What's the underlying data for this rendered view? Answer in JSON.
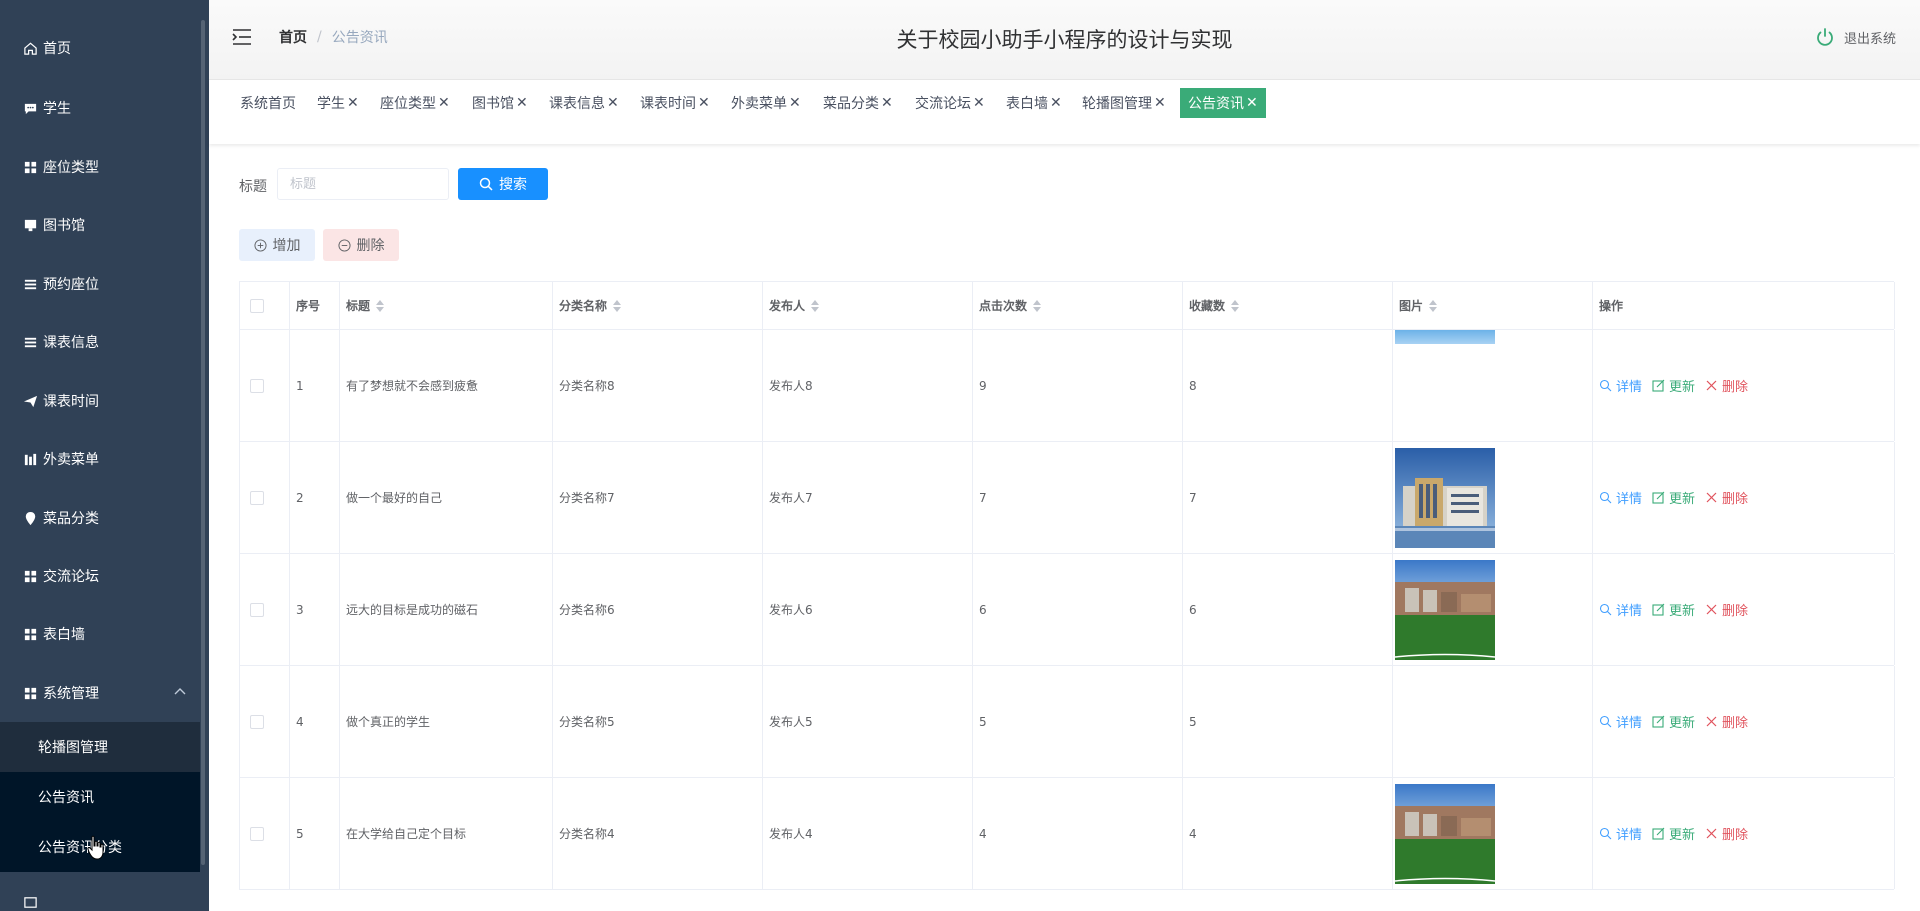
{
  "sidebar": {
    "items": [
      {
        "label": "首页",
        "icon": "home-icon"
      },
      {
        "label": "学生",
        "icon": "chat-icon"
      },
      {
        "label": "座位类型",
        "icon": "grid-icon"
      },
      {
        "label": "图书馆",
        "icon": "board-icon"
      },
      {
        "label": "预约座位",
        "icon": "list-icon"
      },
      {
        "label": "课表信息",
        "icon": "list-icon"
      },
      {
        "label": "课表时间",
        "icon": "send-icon"
      },
      {
        "label": "外卖菜单",
        "icon": "chart-icon"
      },
      {
        "label": "菜品分类",
        "icon": "location-icon"
      },
      {
        "label": "交流论坛",
        "icon": "grid-icon"
      },
      {
        "label": "表白墙",
        "icon": "grid-icon"
      },
      {
        "label": "系统管理",
        "icon": "grid-icon"
      }
    ],
    "sub_items": [
      {
        "label": "轮播图管理"
      },
      {
        "label": "公告资讯"
      },
      {
        "label": "公告资讯分类"
      }
    ]
  },
  "header": {
    "breadcrumb_home": "首页",
    "breadcrumb_sep": "/",
    "breadcrumb_current": "公告资讯",
    "title": "关于校园小助手小程序的设计与实现",
    "logout": "退出系统"
  },
  "tags": [
    {
      "label": "系统首页",
      "closable": false
    },
    {
      "label": "学生",
      "closable": true
    },
    {
      "label": "座位类型",
      "closable": true
    },
    {
      "label": "图书馆",
      "closable": true
    },
    {
      "label": "课表信息",
      "closable": true
    },
    {
      "label": "课表时间",
      "closable": true
    },
    {
      "label": "外卖菜单",
      "closable": true
    },
    {
      "label": "菜品分类",
      "closable": true
    },
    {
      "label": "交流论坛",
      "closable": true
    },
    {
      "label": "表白墙",
      "closable": true
    },
    {
      "label": "轮播图管理",
      "closable": true
    },
    {
      "label": "公告资讯",
      "closable": true,
      "active": true
    }
  ],
  "tag_close": "✕",
  "search": {
    "label": "标题",
    "placeholder": "标题",
    "button": "搜索"
  },
  "actions": {
    "add": "增加",
    "delete": "删除"
  },
  "table": {
    "columns": [
      "序号",
      "标题",
      "分类名称",
      "发布人",
      "点击次数",
      "收藏数",
      "图片",
      "操作"
    ],
    "rows": [
      {
        "no": "1",
        "title": "有了梦想就不会感到疲惫",
        "category": "分类名称8",
        "publisher": "发布人8",
        "clicks": "9",
        "favorites": "8",
        "image": "sky-strip"
      },
      {
        "no": "2",
        "title": "做一个最好的自己",
        "category": "分类名称7",
        "publisher": "发布人7",
        "clicks": "7",
        "favorites": "7",
        "image": "building"
      },
      {
        "no": "3",
        "title": "远大的目标是成功的磁石",
        "category": "分类名称6",
        "publisher": "发布人6",
        "clicks": "6",
        "favorites": "6",
        "image": "campus-field"
      },
      {
        "no": "4",
        "title": "做个真正的学生",
        "category": "分类名称5",
        "publisher": "发布人5",
        "clicks": "5",
        "favorites": "5",
        "image": "none"
      },
      {
        "no": "5",
        "title": "在大学给自己定个目标",
        "category": "分类名称4",
        "publisher": "发布人4",
        "clicks": "4",
        "favorites": "4",
        "image": "campus-field"
      }
    ],
    "op_detail": "详情",
    "op_update": "更新",
    "op_delete": "删除"
  },
  "colors": {
    "sidebar_bg": "#304156",
    "submenu_bg": "#1f2d3d",
    "active_tag": "#3aab78",
    "search_button": "#1890ff"
  }
}
